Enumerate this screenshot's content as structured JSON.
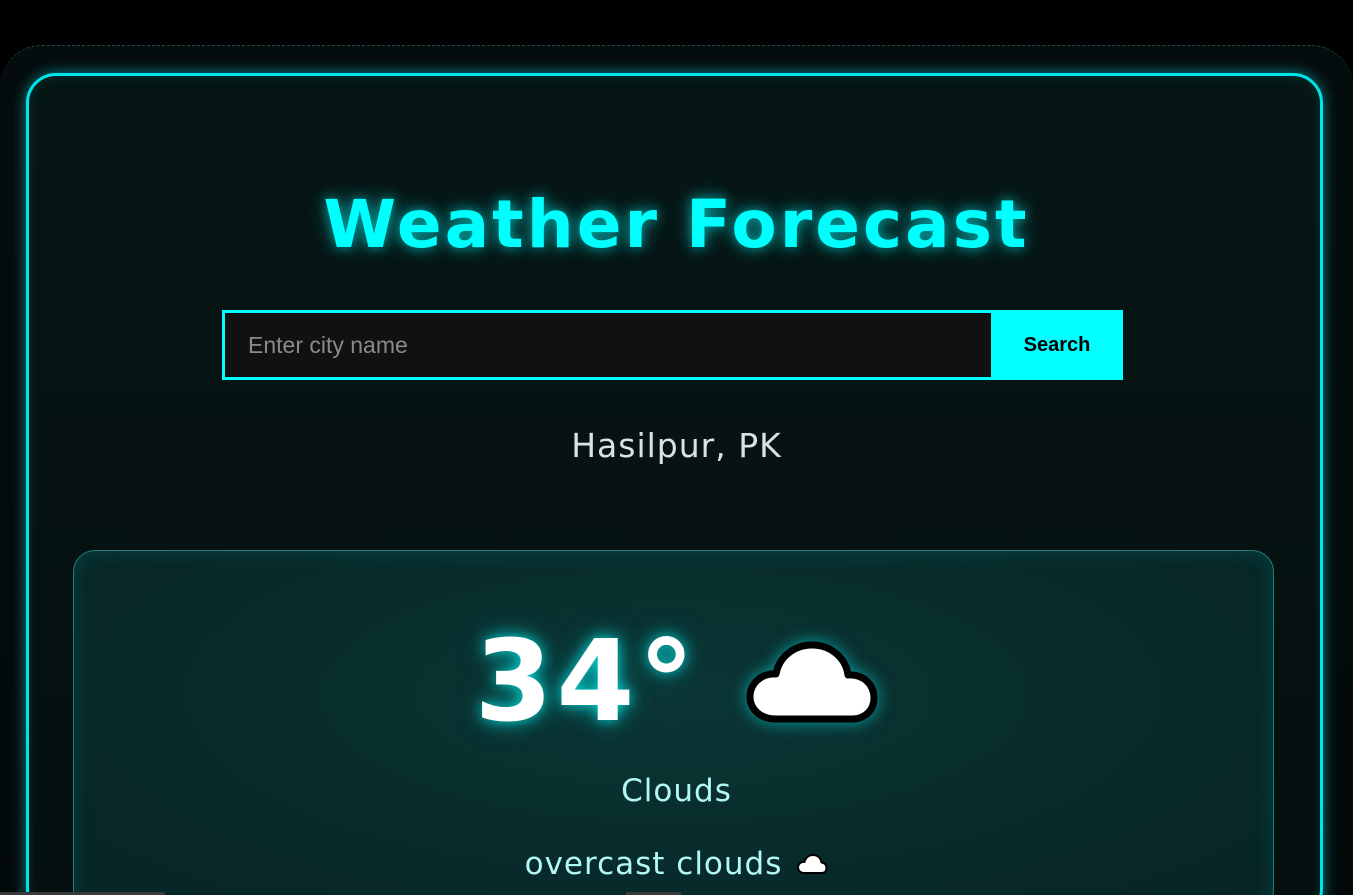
{
  "app": {
    "title": "Weather Forecast"
  },
  "search": {
    "placeholder": "Enter city name",
    "value": "",
    "button_label": "Search"
  },
  "location": {
    "city": "Hasilpur, PK"
  },
  "weather": {
    "temperature": "34°",
    "condition": "Clouds",
    "description": "overcast clouds",
    "icon": "cloud-icon",
    "description_icon": "small-cloud-icon"
  },
  "colors": {
    "accent": "#00ffff",
    "background": "#000000",
    "card": "#082a2a",
    "text_light": "#b3f7f7"
  }
}
